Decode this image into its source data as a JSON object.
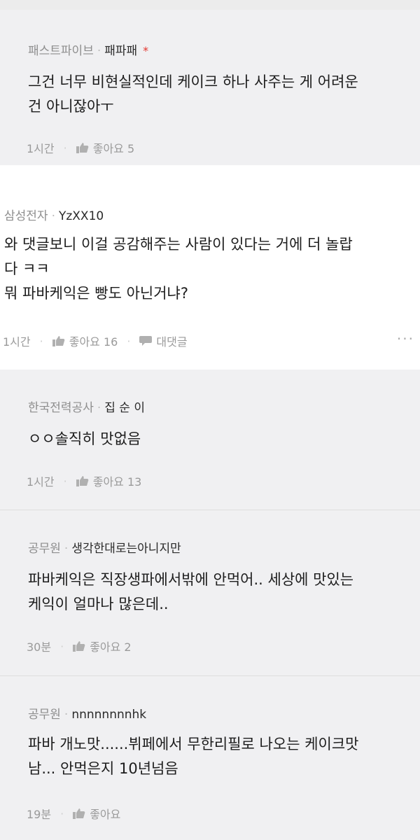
{
  "comments": [
    {
      "affiliation": "패스트파이브",
      "nickname": "패파패",
      "star": "*",
      "lines": [
        "그건 너무 비현실적인데 케이크 하나 사주는 게 어려운",
        "건 아니잖아ㅜ"
      ],
      "time": "1시간",
      "like_label": "좋아요 5"
    },
    {
      "affiliation": "삼성전자",
      "nickname": "YzXX10",
      "lines": [
        "와 댓글보니 이걸 공감해주는 사람이 있다는 거에 더 놀랍",
        "다 ㅋㅋ",
        "뭐 파바케익은 빵도 아닌거냐?"
      ],
      "time": "1시간",
      "like_label": "좋아요 16",
      "reply_label": "대댓글",
      "more_label": "···"
    },
    {
      "affiliation": "한국전력공사",
      "nickname": "집 순 이",
      "lines": [
        "ㅇㅇ솔직히 맛없음"
      ],
      "time": "1시간",
      "like_label": "좋아요 13"
    },
    {
      "affiliation": "공무원",
      "nickname": "생각한대로는아니지만",
      "lines": [
        "파바케익은 직장생파에서밖에 안먹어.. 세상에 맛있는",
        "케익이 얼마나 많은데.."
      ],
      "time": "30분",
      "like_label": "좋아요 2"
    },
    {
      "affiliation": "공무원",
      "nickname": "nnnnnnnnhk",
      "lines": [
        "파바 개노맛......뷔페에서 무한리필로 나오는 케이크맛",
        "남... 안먹은지 10년넘음"
      ],
      "time": "19분",
      "like_label": "좋아요"
    }
  ],
  "colors": {
    "reply_bg": "#f0f0f2",
    "main_bg": "#ffffff",
    "star": "#e3362f",
    "meta_text": "#8e8e8e"
  },
  "icons": {
    "like": "thumbs-up-icon",
    "reply": "speech-bubble-icon",
    "more": "more-icon"
  }
}
